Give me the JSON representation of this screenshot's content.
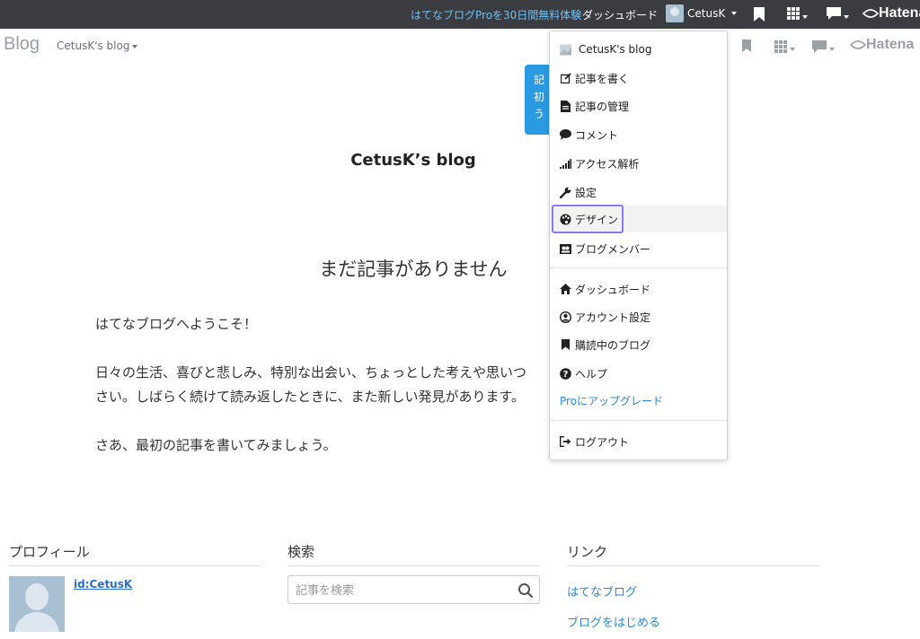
{
  "topbar": {
    "promo": "はてなブログProを30日間無料体験",
    "dashboard": "ダッシュボード",
    "username": "CetusK",
    "logo": "Hatena"
  },
  "subbar": {
    "blog_label": "Blog",
    "blog_name": "CetusK's blog",
    "logo": "Hatena"
  },
  "tooltip": {
    "lines": [
      "記",
      "初",
      "う"
    ]
  },
  "main": {
    "blog_title": "CetusK’s blog",
    "no_entry": "まだ記事がありません",
    "paragraphs": [
      "はてなブログへようこそ！",
      "日々の生活、喜びと悲しみ、特別な出会い、ちょっとした考えや思いつ",
      "さい。しばらく続けて読み返したときに、また新しい発見があります。",
      "さあ、最初の記事を書いてみましょう。"
    ]
  },
  "footer": {
    "profile_heading": "プロフィール",
    "profile_id": "id:CetusK",
    "search_heading": "検索",
    "search_placeholder": "記事を検索",
    "links_heading": "リンク",
    "links": [
      "はてなブログ",
      "ブログをはじめる"
    ]
  },
  "dropdown": {
    "items": [
      {
        "label": "CetusK's blog",
        "icon": "blog-thumbnail-icon"
      },
      {
        "label": "記事を書く",
        "icon": "edit-icon"
      },
      {
        "label": "記事の管理",
        "icon": "document-icon"
      },
      {
        "label": "コメント",
        "icon": "comment-icon"
      },
      {
        "label": "アクセス解析",
        "icon": "signal-bars-icon"
      },
      {
        "label": "設定",
        "icon": "wrench-icon"
      },
      {
        "label": "デザイン",
        "icon": "palette-icon"
      },
      {
        "label": "ブログメンバー",
        "icon": "members-icon"
      },
      {
        "label": "ダッシュボード",
        "icon": "home-icon"
      },
      {
        "label": "アカウント設定",
        "icon": "user-circle-icon"
      },
      {
        "label": "購読中のブログ",
        "icon": "bookmark-icon"
      },
      {
        "label": "ヘルプ",
        "icon": "help-icon"
      },
      {
        "label": "Proにアップグレード",
        "icon": ""
      },
      {
        "label": "ログアウト",
        "icon": "logout-icon"
      }
    ]
  },
  "colors": {
    "topbar_bg": "#3a3c3f",
    "promo_link": "#6cc0f6",
    "accent_blue": "#2a8ad6",
    "highlight_border": "#8b7bf2"
  }
}
